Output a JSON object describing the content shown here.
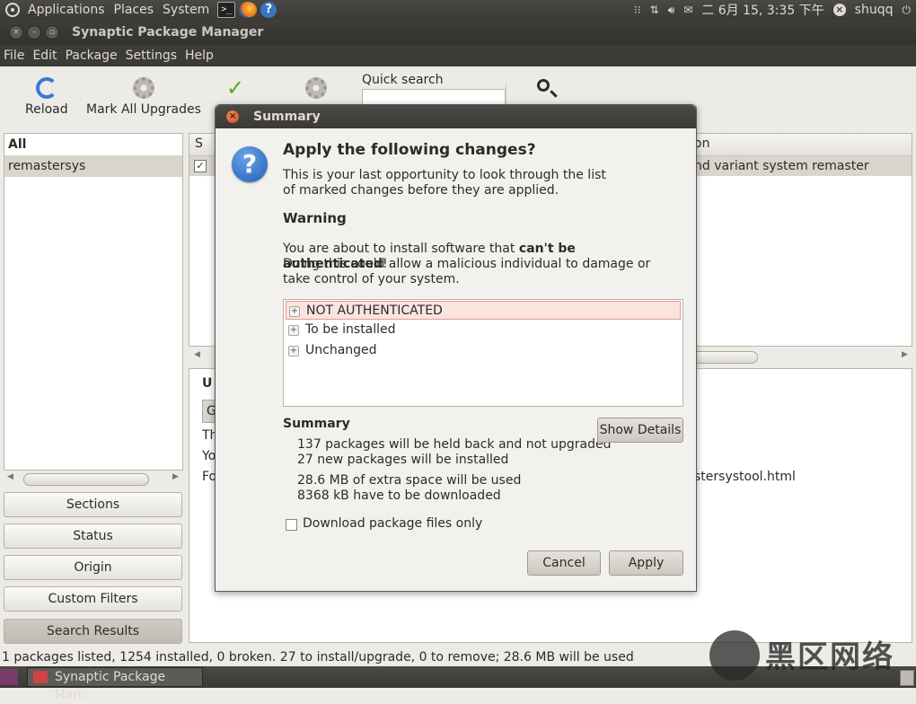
{
  "top_panel": {
    "menus": [
      "Applications",
      "Places",
      "System"
    ],
    "date": "二 6月 15,",
    "time": "3:35 下午",
    "user": "shuqq"
  },
  "window": {
    "title": "Synaptic Package Manager"
  },
  "menubar": [
    "File",
    "Edit",
    "Package",
    "Settings",
    "Help"
  ],
  "toolbar": {
    "reload": "Reload",
    "mark_all_upgrades": "Mark All Upgrades",
    "quick_search_label": "Quick search",
    "quick_search_value": ""
  },
  "left_pane": {
    "items": [
      "All",
      "remastersys"
    ],
    "buttons": [
      "Sections",
      "Status",
      "Origin",
      "Custom Filters",
      "Search Results"
    ]
  },
  "package_list": {
    "col_s": "S",
    "col_desc_partial": "on",
    "row_desc_partial": "nd variant system remaster"
  },
  "details": {
    "heading_partial": "U",
    "button_partial": "G",
    "line1_partial": "Th",
    "line2_partial": "Yo",
    "line3_partial": "Fo",
    "link_partial": "stersystool.html"
  },
  "statusbar": "1 packages listed, 1254 installed, 0 broken. 27 to install/upgrade, 0 to remove; 28.6 MB will be used",
  "taskbar": {
    "task_label": "Synaptic Package Man..."
  },
  "watermark": "黑区网络",
  "dialog": {
    "title": "Summary",
    "heading": "Apply the following changes?",
    "intro_line1": "This is your last opportunity to look through the list",
    "intro_line2": "of marked changes before they are applied.",
    "warning_heading": "Warning",
    "warning_pre": "You are about to install software that ",
    "warning_bold": "can't be authenticated",
    "warning_post": "!",
    "warning_line2": "Doing this could allow a malicious individual to damage or",
    "warning_line3": "take control of your system.",
    "changes": [
      "NOT AUTHENTICATED",
      "To be installed",
      "Unchanged"
    ],
    "summary_heading": "Summary",
    "summary_lines": [
      "137 packages will be held back and not upgraded",
      "27 new packages will be installed",
      "28.6 MB of extra space will be used",
      "8368 kB have to be downloaded"
    ],
    "show_details": "Show Details",
    "download_only": "Download package files only",
    "cancel": "Cancel",
    "apply": "Apply"
  },
  "colors": {
    "panel_bg": "#3c3b37",
    "selected_row": "#fbe3df",
    "accent_blue": "#1f5fb8"
  }
}
